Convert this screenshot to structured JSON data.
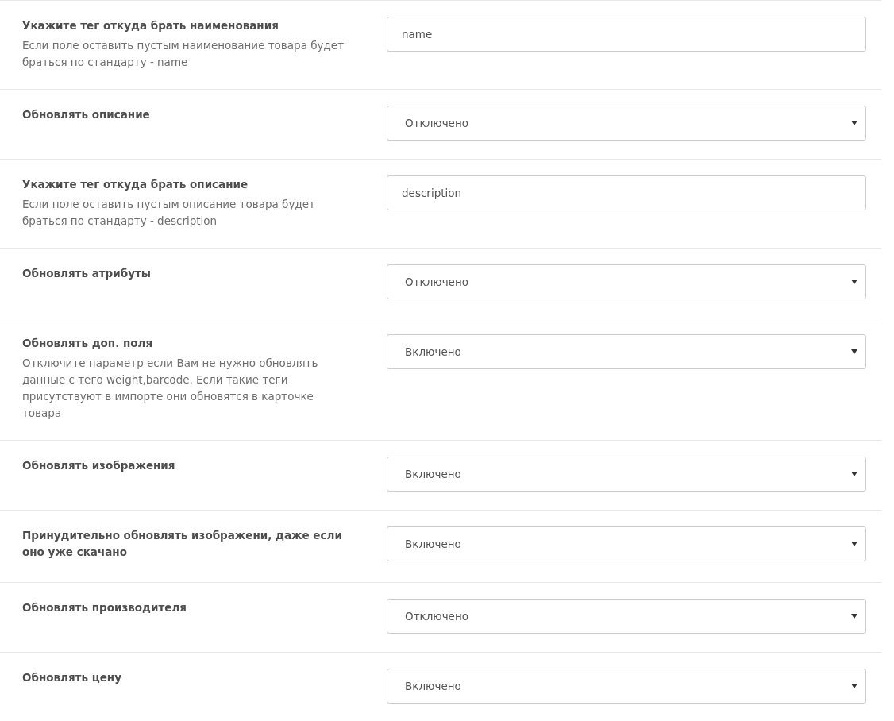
{
  "rows": [
    {
      "label": "Укажите тег откуда брать наименования",
      "help": "Если поле оставить пустым наименование товара будет браться по стандарту - name",
      "kind": "text",
      "value": "name"
    },
    {
      "label": "Обновлять описание",
      "kind": "select",
      "value": "Отключено"
    },
    {
      "label": "Укажите тег откуда брать описание",
      "help": "Если поле оставить пустым описание товара будет браться по стандарту - description",
      "kind": "text",
      "value": "description"
    },
    {
      "label": "Обновлять атрибуты",
      "kind": "select",
      "value": "Отключено"
    },
    {
      "label": "Обновлять доп. поля",
      "help": "Отключите параметр если Вам не нужно обновлять данные с тего weight,barcode. Если такие теги присутствуют в импорте они обновятся в карточке товара",
      "kind": "select",
      "value": "Включено"
    },
    {
      "label": "Обновлять изображения",
      "kind": "select",
      "value": "Включено"
    },
    {
      "label": "Принудительно обновлять изображени, даже если оно уже скачано",
      "kind": "select",
      "value": "Включено"
    },
    {
      "label": "Обновлять производителя",
      "kind": "select",
      "value": "Отключено"
    },
    {
      "label": "Обновлять цену",
      "kind": "select",
      "value": "Включено"
    }
  ]
}
